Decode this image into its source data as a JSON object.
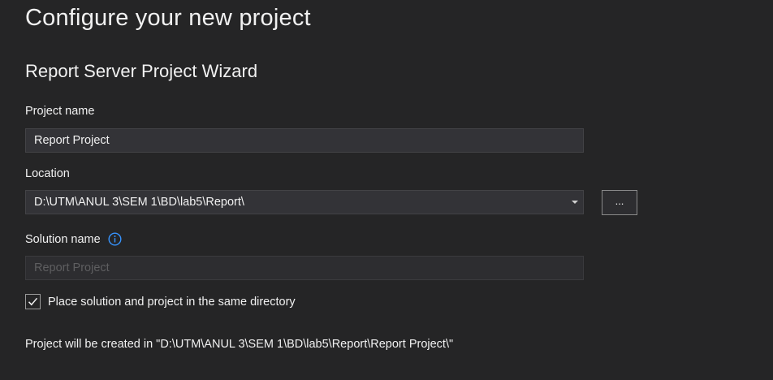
{
  "header": {
    "title": "Configure your new project",
    "subtitle": "Report Server Project Wizard"
  },
  "form": {
    "project_name": {
      "label": "Project name",
      "value": "Report Project"
    },
    "location": {
      "label": "Location",
      "value": "D:\\UTM\\ANUL 3\\SEM 1\\BD\\lab5\\Report\\",
      "browse_label": "..."
    },
    "solution_name": {
      "label": "Solution name",
      "placeholder": "Report Project",
      "icon": "info-icon"
    },
    "same_directory": {
      "label": "Place solution and project in the same directory",
      "checked": true
    },
    "created_in_note": "Project will be created in \"D:\\UTM\\ANUL 3\\SEM 1\\BD\\lab5\\Report\\Report Project\\\""
  },
  "colors": {
    "background": "#252526",
    "input_background": "#333337",
    "info_icon": "#3794ff"
  }
}
